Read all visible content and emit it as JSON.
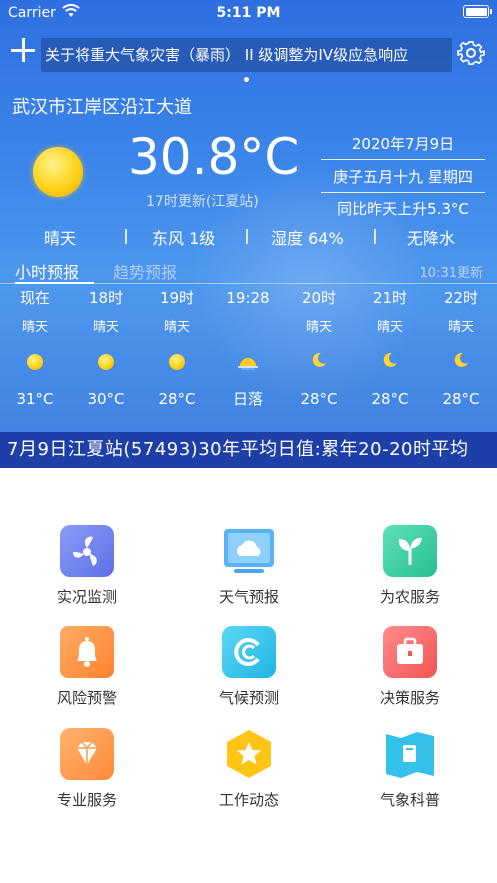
{
  "status": {
    "carrier": "Carrier",
    "time": "5:11 PM"
  },
  "notice": {
    "text": "关于将重大气象灾害（暴雨） II 级调整为IV级应急响应"
  },
  "location": "武汉市江岸区沿江大道",
  "current": {
    "temperature": "30.8°C",
    "update": "17时更新(江夏站)",
    "date": "2020年7月9日",
    "lunar": "庚子五月十九 星期四",
    "compare": "同比昨天上升5.3°C"
  },
  "conditions": [
    "晴天",
    "东风 1级",
    "湿度 64%",
    "无降水"
  ],
  "tabs": {
    "active": "小时预报",
    "inactive": "趋势预报",
    "refresh": "10:31更新"
  },
  "hourly": [
    {
      "time": "现在",
      "weather": "晴天",
      "icon": "sun-icon",
      "temp": "31°C"
    },
    {
      "time": "18时",
      "weather": "晴天",
      "icon": "sun-icon",
      "temp": "30°C"
    },
    {
      "time": "19时",
      "weather": "晴天",
      "icon": "sun-icon",
      "temp": "28°C"
    },
    {
      "time": "19:28",
      "weather": "",
      "icon": "sunset-icon",
      "temp": "日落"
    },
    {
      "time": "20时",
      "weather": "晴天",
      "icon": "moon-icon",
      "temp": "28°C"
    },
    {
      "time": "21时",
      "weather": "晴天",
      "icon": "moon-icon",
      "temp": "28°C"
    },
    {
      "time": "22时",
      "weather": "晴天",
      "icon": "moon-icon",
      "temp": "28°C"
    }
  ],
  "ticker": "7月9日江夏站(57493)30年平均日值:累年20-20时平均",
  "menu": [
    {
      "label": "实况监测",
      "icon": "monitor-fan-icon",
      "color": "#6d83f0"
    },
    {
      "label": "天气预报",
      "icon": "weather-screen-icon",
      "color": "#4aa5f0"
    },
    {
      "label": "为农服务",
      "icon": "sprout-icon",
      "color": "#36cfa3"
    },
    {
      "label": "风险预警",
      "icon": "bell-icon",
      "color": "#ff9548"
    },
    {
      "label": "气候预测",
      "icon": "climate-c-icon",
      "color": "#2ec3ea"
    },
    {
      "label": "决策服务",
      "icon": "briefcase-icon",
      "color": "#ff6b6b"
    },
    {
      "label": "专业服务",
      "icon": "diamond-icon",
      "color": "#ff9a50"
    },
    {
      "label": "工作动态",
      "icon": "star-hexagon-icon",
      "color": "#ffc414"
    },
    {
      "label": "气象科普",
      "icon": "book-map-icon",
      "color": "#35c2ea"
    }
  ]
}
